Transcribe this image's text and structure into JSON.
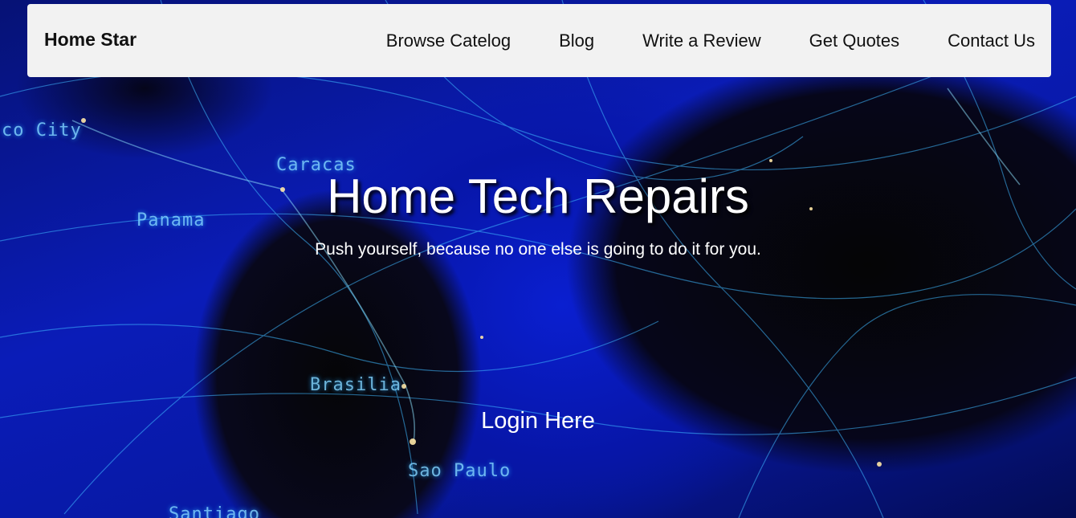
{
  "navbar": {
    "brand": "Home Star",
    "links": [
      {
        "label": "Browse Catelog"
      },
      {
        "label": "Blog"
      },
      {
        "label": "Write a Review"
      },
      {
        "label": "Get Quotes"
      },
      {
        "label": "Contact Us"
      }
    ]
  },
  "hero": {
    "title": "Home Tech Repairs",
    "subtitle": "Push yourself, because no one else is going to do it for you.",
    "login_label": "Login Here",
    "map_labels": [
      "co City",
      "Caracas",
      "Panama",
      "Brasilia",
      "Sao Paulo",
      "Santiago"
    ]
  },
  "colors": {
    "navbar_bg": "#f2f2f2",
    "hero_bg": "#0a1cb8",
    "text_light": "#ffffff"
  }
}
